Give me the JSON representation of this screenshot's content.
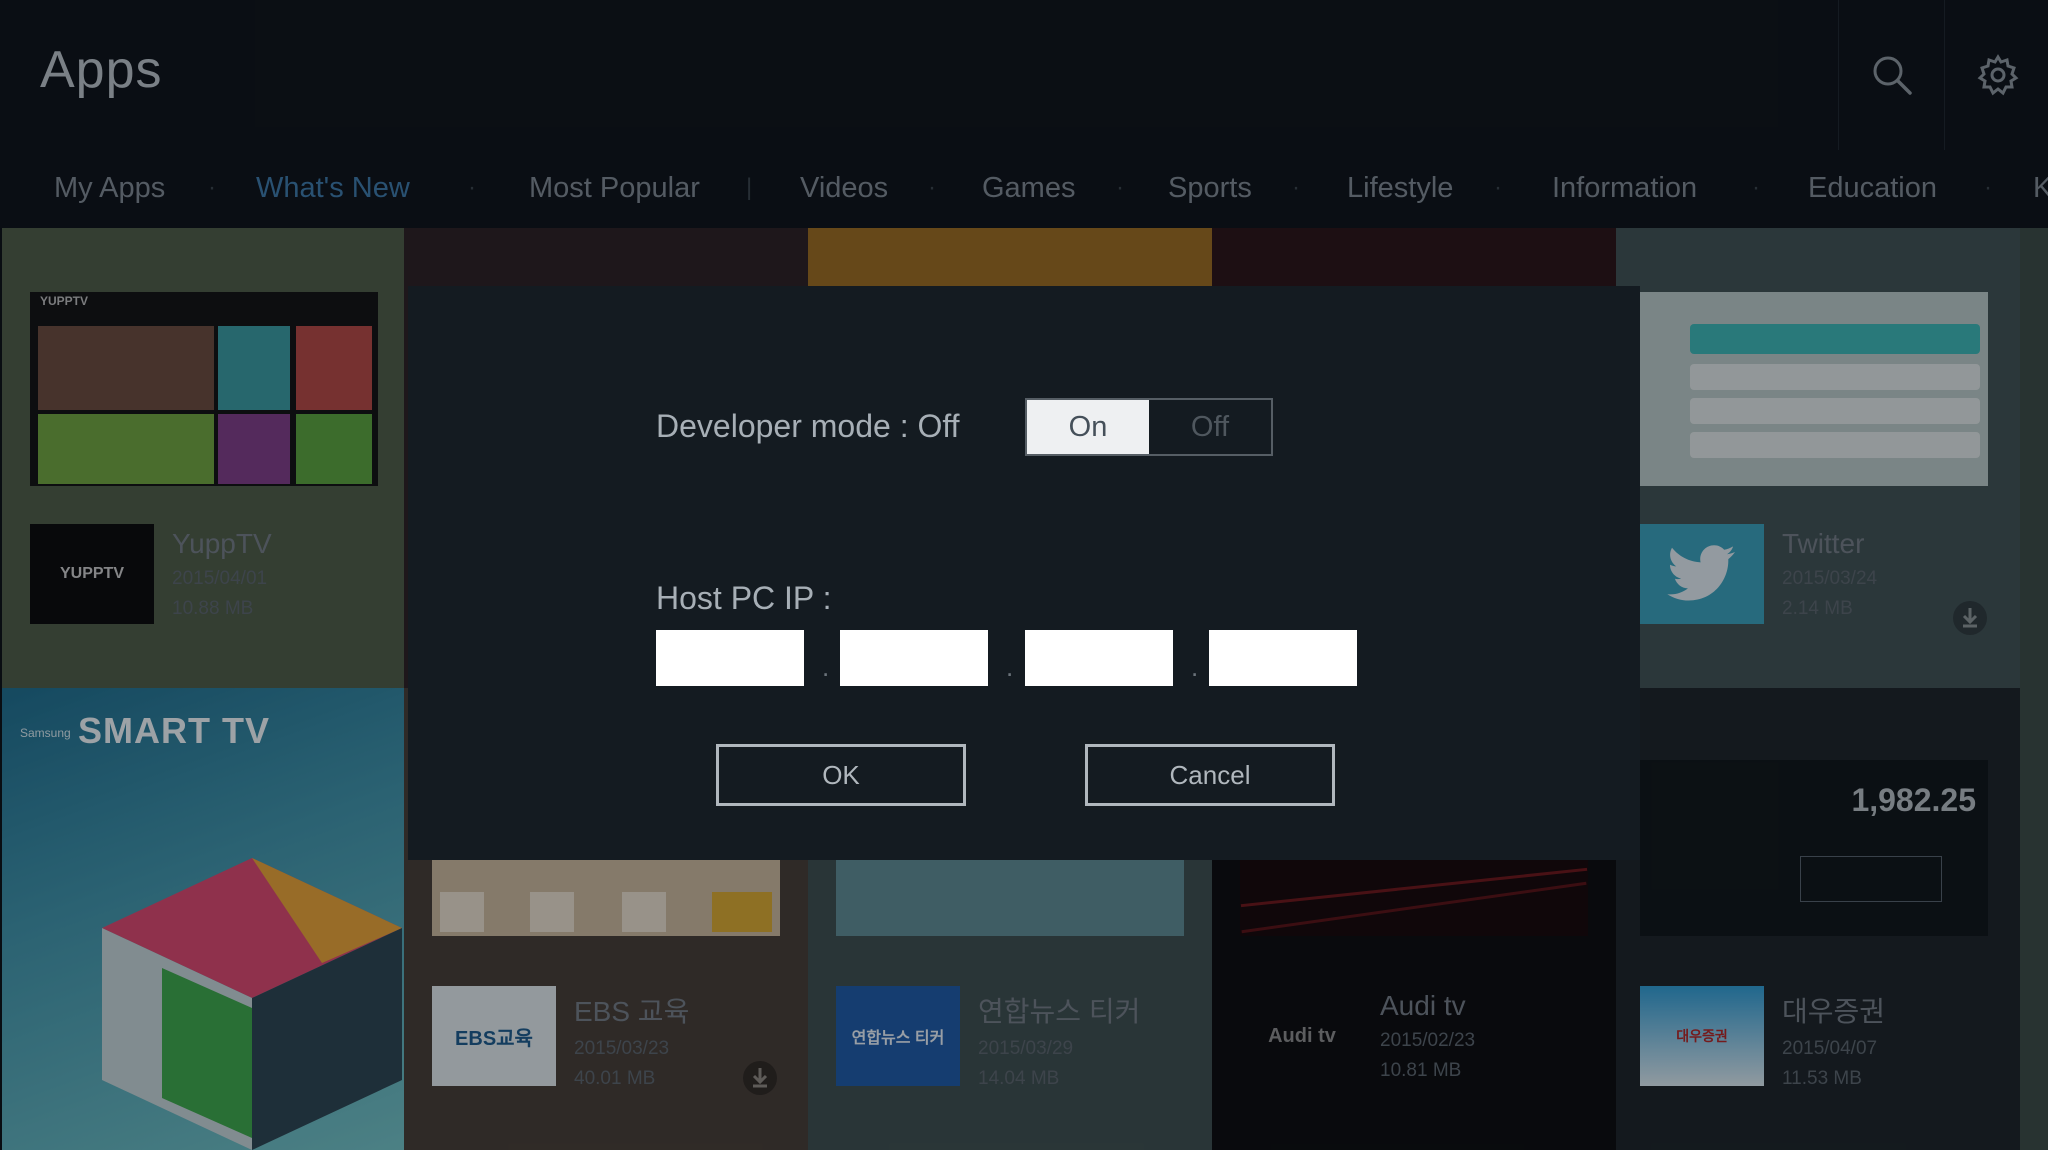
{
  "header": {
    "title": "Apps",
    "search_icon": "search-icon",
    "settings_icon": "gear-icon"
  },
  "tabs": [
    {
      "label": "My Apps"
    },
    {
      "label": "What's New",
      "active": true
    },
    {
      "label": "Most Popular"
    },
    {
      "label": "Videos"
    },
    {
      "label": "Games"
    },
    {
      "label": "Sports"
    },
    {
      "label": "Lifestyle"
    },
    {
      "label": "Information"
    },
    {
      "label": "Education"
    },
    {
      "label": "K"
    }
  ],
  "apps": [
    {
      "name": "YuppTV",
      "date": "2015/04/01",
      "size": "10.88 MB",
      "icon_text": "YUPPTV"
    },
    {
      "name": "Twitter",
      "date": "2015/03/24",
      "size": "2.14 MB",
      "icon": "twitter-bird-icon"
    },
    {
      "name": "EBS 교육",
      "date": "2015/03/23",
      "size": "40.01 MB",
      "icon_text": "EBS교육"
    },
    {
      "name": "연합뉴스 티커",
      "date": "2015/03/29",
      "size": "14.04 MB",
      "icon_text": "연합뉴스 티커"
    },
    {
      "name": "Audi tv",
      "date": "2015/02/23",
      "size": "10.81 MB",
      "icon_text": "Audi tv"
    },
    {
      "name": "대우증권",
      "date": "2015/04/07",
      "size": "11.53 MB",
      "icon_text": "대우증권"
    }
  ],
  "banner": {
    "brand_small": "Samsung",
    "brand": "SMART TV"
  },
  "stock_thumb": {
    "value": "1,982.25"
  },
  "thumb_labels": {
    "yupptv": "YUPPTV"
  },
  "dialog": {
    "developer_mode_label": "Developer mode : Off",
    "toggle_on": "On",
    "toggle_off": "Off",
    "toggle_selected": "On",
    "host_ip_label": "Host PC IP :",
    "ip_fields": [
      "",
      "",
      "",
      ""
    ],
    "ip_separator": ".",
    "ok_label": "OK",
    "cancel_label": "Cancel"
  },
  "colors": {
    "active_tab": "#3d78a8",
    "dialog_bg": "#141b21",
    "tile_green": "#4f5d47",
    "tile_teal": "#3f5052"
  }
}
